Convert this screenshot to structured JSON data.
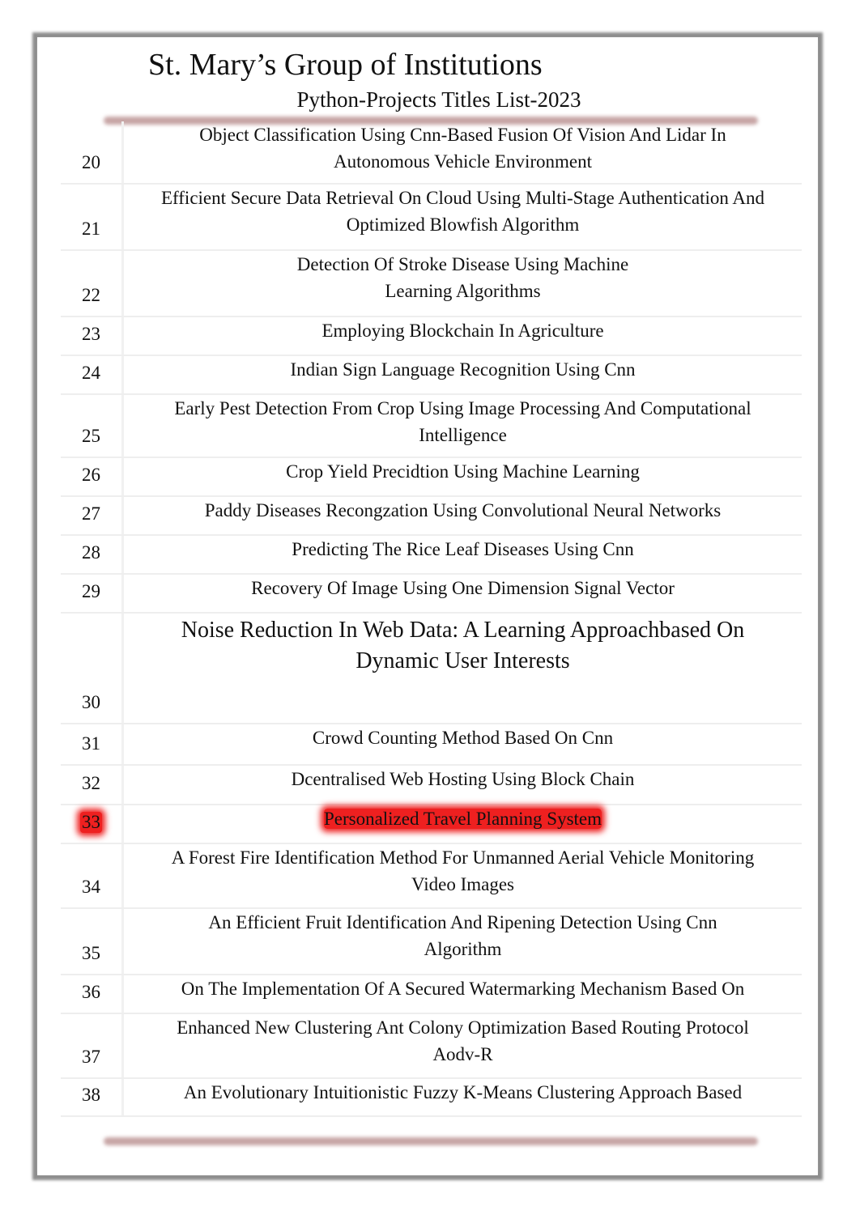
{
  "header": {
    "title": "St. Mary’s Group of Institutions",
    "subtitle": "Python-Projects Titles List-2023"
  },
  "colors": {
    "highlight": "#ee2020",
    "rule": "#c7a5a5",
    "frame": "#8d8d8d"
  },
  "rows": [
    {
      "no": "20",
      "lines": [
        "Object Classification Using Cnn-Based Fusion Of Vision And Lidar In",
        "Autonomous Vehicle Environment"
      ]
    },
    {
      "no": "21",
      "lines": [
        "Efficient Secure Data Retrieval On Cloud Using Multi-Stage Authentication And",
        "Optimized Blowfish Algorithm"
      ]
    },
    {
      "no": "22",
      "lines": [
        "Detection Of Stroke Disease Using Machine",
        "Learning Algorithms"
      ]
    },
    {
      "no": "23",
      "lines": [
        "Employing Blockchain In Agriculture"
      ]
    },
    {
      "no": "24",
      "lines": [
        "Indian Sign Language Recognition Using Cnn"
      ]
    },
    {
      "no": "25",
      "lines": [
        "Early Pest Detection From Crop Using Image Processing And Computational",
        "Intelligence"
      ]
    },
    {
      "no": "26",
      "lines": [
        "Crop Yield Precidtion Using Machine Learning"
      ]
    },
    {
      "no": "27",
      "lines": [
        "Paddy Diseases Recongzation Using Convolutional Neural Networks"
      ]
    },
    {
      "no": "28",
      "lines": [
        "Predicting The Rice Leaf Diseases Using Cnn"
      ]
    },
    {
      "no": "29",
      "lines": [
        "Recovery Of Image Using One Dimension Signal Vector"
      ]
    },
    {
      "no": "30",
      "lines": [
        "Noise Reduction In Web Data: A Learning Approachbased On",
        "Dynamic User Interests"
      ],
      "large": true
    },
    {
      "no": "31",
      "lines": [
        "Crowd Counting Method Based On Cnn"
      ]
    },
    {
      "no": "32",
      "lines": [
        "Dcentralised Web Hosting Using Block Chain"
      ]
    },
    {
      "no": "33",
      "lines": [
        "Personalized Travel Planning System"
      ],
      "highlighted": true
    },
    {
      "no": "34",
      "lines": [
        "A Forest Fire Identification Method For Unmanned Aerial Vehicle Monitoring",
        "Video Images"
      ]
    },
    {
      "no": "35",
      "lines": [
        "An Efficient Fruit Identification And Ripening Detection Using Cnn",
        "Algorithm"
      ]
    },
    {
      "no": "36",
      "lines": [
        "On The Implementation Of A Secured Watermarking Mechanism Based On"
      ]
    },
    {
      "no": "37",
      "lines": [
        "Enhanced New Clustering Ant Colony Optimization Based Routing Protocol",
        "Aodv-R"
      ]
    },
    {
      "no": "38",
      "lines": [
        "An Evolutionary Intuitionistic Fuzzy K-Means Clustering Approach Based"
      ]
    }
  ]
}
